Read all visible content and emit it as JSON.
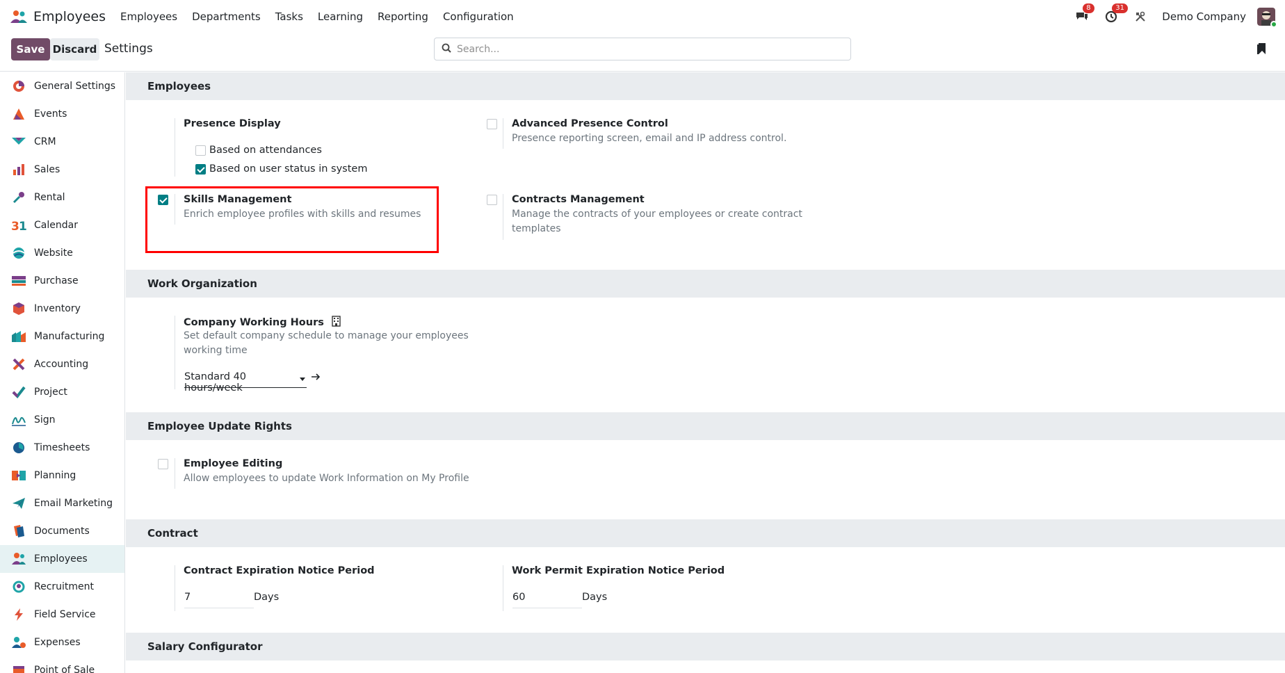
{
  "navbar": {
    "app_title": "Employees",
    "menu": [
      "Employees",
      "Departments",
      "Tasks",
      "Learning",
      "Reporting",
      "Configuration"
    ],
    "messages_count": "8",
    "activities_count": "31",
    "company": "Demo Company"
  },
  "control": {
    "save_label": "Save",
    "discard_label": "Discard",
    "title": "Settings",
    "search_placeholder": "Search..."
  },
  "sidebar": {
    "items": [
      {
        "label": "General Settings",
        "icon": "general-settings-icon",
        "color": "#e0533b"
      },
      {
        "label": "Events",
        "icon": "events-icon",
        "color": "#e95c2a"
      },
      {
        "label": "CRM",
        "icon": "crm-icon",
        "color": "#1fa4a8"
      },
      {
        "label": "Sales",
        "icon": "sales-icon",
        "color": "#e0533b"
      },
      {
        "label": "Rental",
        "icon": "rental-icon",
        "color": "#7b3f8a"
      },
      {
        "label": "Calendar",
        "icon": "calendar-icon",
        "color": "#1b8a8f"
      },
      {
        "label": "Website",
        "icon": "website-icon",
        "color": "#1b8a8f"
      },
      {
        "label": "Purchase",
        "icon": "purchase-icon",
        "color": "#7b3f8a"
      },
      {
        "label": "Inventory",
        "icon": "inventory-icon",
        "color": "#e0533b"
      },
      {
        "label": "Manufacturing",
        "icon": "manufacturing-icon",
        "color": "#1b8a8f"
      },
      {
        "label": "Accounting",
        "icon": "accounting-icon",
        "color": "#e95c2a"
      },
      {
        "label": "Project",
        "icon": "project-icon",
        "color": "#1b8a8f"
      },
      {
        "label": "Sign",
        "icon": "sign-icon",
        "color": "#1b8a8f"
      },
      {
        "label": "Timesheets",
        "icon": "timesheets-icon",
        "color": "#1b5a8f"
      },
      {
        "label": "Planning",
        "icon": "planning-icon",
        "color": "#e95c2a"
      },
      {
        "label": "Email Marketing",
        "icon": "email-marketing-icon",
        "color": "#1b8a8f"
      },
      {
        "label": "Documents",
        "icon": "documents-icon",
        "color": "#e95c2a"
      },
      {
        "label": "Employees",
        "icon": "employees-icon",
        "color": "#7b3f8a",
        "active": true
      },
      {
        "label": "Recruitment",
        "icon": "recruitment-icon",
        "color": "#1fa4a8"
      },
      {
        "label": "Field Service",
        "icon": "field-service-icon",
        "color": "#e0533b"
      },
      {
        "label": "Expenses",
        "icon": "expenses-icon",
        "color": "#1b8a8f"
      },
      {
        "label": "Point of Sale",
        "icon": "point-of-sale-icon",
        "color": "#e95c2a"
      }
    ]
  },
  "sections": {
    "employees": {
      "title": "Employees",
      "presence_display": {
        "title": "Presence Display",
        "options": [
          {
            "label": "Based on attendances",
            "checked": false
          },
          {
            "label": "Based on user status in system",
            "checked": true
          }
        ]
      },
      "advanced_presence": {
        "title": "Advanced Presence Control",
        "desc": "Presence reporting screen, email and IP address control.",
        "checked": false
      },
      "skills": {
        "title": "Skills Management",
        "desc": "Enrich employee profiles with skills and resumes",
        "checked": true
      },
      "contracts": {
        "title": "Contracts Management",
        "desc_line1": "Manage the contracts of your employees or create contract",
        "desc_line2": "templates",
        "checked": false
      }
    },
    "work_org": {
      "title": "Work Organization",
      "working_hours": {
        "title": "Company Working Hours",
        "desc_line1": "Set default company schedule to manage your employees",
        "desc_line2": "working time",
        "value": "Standard 40 hours/week"
      }
    },
    "update_rights": {
      "title": "Employee Update Rights",
      "editing": {
        "title": "Employee Editing",
        "desc": "Allow employees to update Work Information on My Profile",
        "checked": false
      }
    },
    "contract": {
      "title": "Contract",
      "expiration": {
        "title": "Contract Expiration Notice Period",
        "value": "7",
        "unit": "Days"
      },
      "permit": {
        "title": "Work Permit Expiration Notice Period",
        "value": "60",
        "unit": "Days"
      }
    },
    "salary": {
      "title": "Salary Configurator"
    }
  },
  "colors": {
    "primary": "#714b67",
    "accent": "#017e84",
    "highlight": "#ff0000"
  }
}
